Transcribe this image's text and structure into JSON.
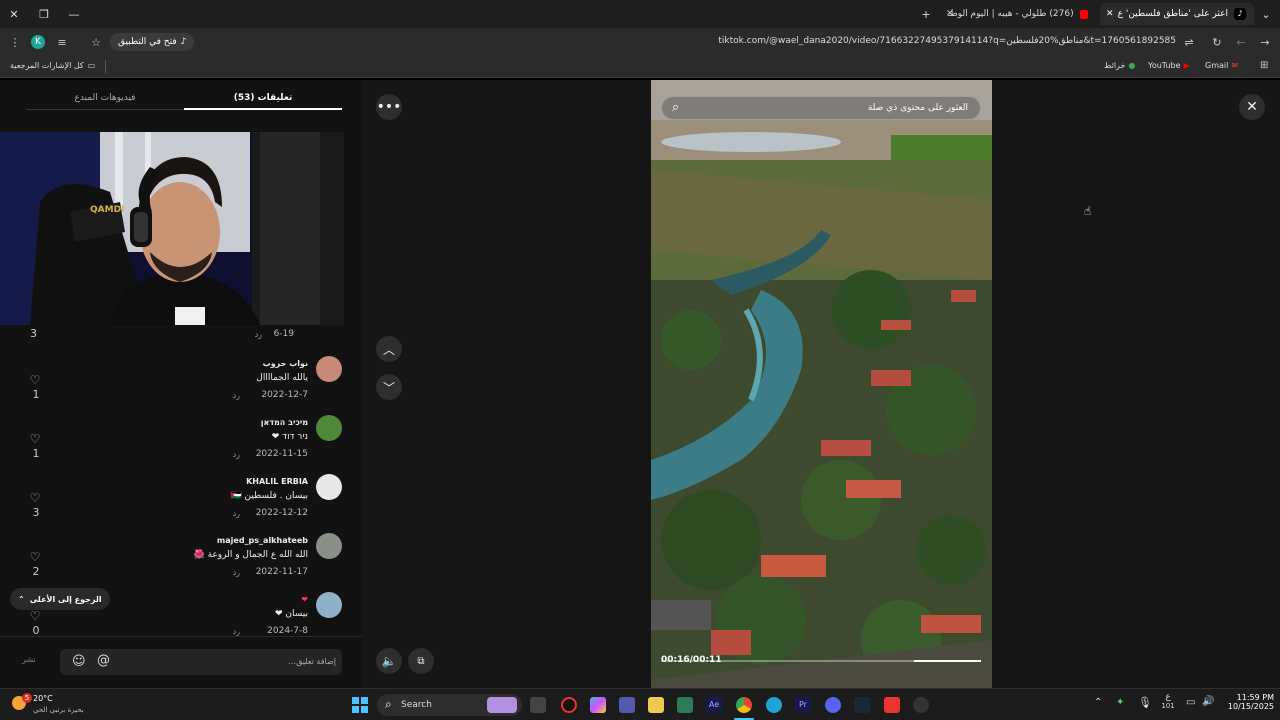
{
  "browser": {
    "tabs": [
      {
        "title": "اعثر على 'مناطق فلسطين' ع",
        "active": true
      },
      {
        "title": "(276) طلولي - هيبه | اليوم الوطـ",
        "active": false
      }
    ],
    "url": "tiktok.com/@wael_dana2020/video/7166322749537914114?q=مناطق%20فلسطين&t=1760561892585",
    "open_app_label": "فتح في التطبيق",
    "profile_initial": "K",
    "bookmarks": {
      "all_bookmarks": "كل الإشارات المرجعية",
      "items": [
        "Gmail",
        "YouTube",
        "خرائط"
      ]
    }
  },
  "comments_panel": {
    "tabs": [
      {
        "label": "تعليقات (53)",
        "active": true
      },
      {
        "label": "فيديوهات المبدع",
        "active": false
      }
    ],
    "partial_comment": {
      "date": "6-19",
      "reply": "رد",
      "likes": "3"
    },
    "comments": [
      {
        "name": "نواب حروب",
        "text": "يالله الجماااال",
        "date": "2022-12-7",
        "reply": "رد",
        "likes": "1",
        "avatar_color": "#c98a7a"
      },
      {
        "name": "מיכיב המדאן",
        "text": "ניר דוד ❤",
        "date": "2022-11-15",
        "reply": "رد",
        "likes": "1",
        "avatar_color": "#4f8a3a"
      },
      {
        "name": "KHALIL ERBIA",
        "text": "بيسان . فلسطين 🇵🇸",
        "date": "2022-12-12",
        "reply": "رد",
        "likes": "3",
        "avatar_color": "#e8e8e8"
      },
      {
        "name": "majed_ps_alkhateeb",
        "text": "الله الله ع الجمال و الروعة 🌺",
        "date": "2022-11-17",
        "reply": "رد",
        "likes": "2",
        "avatar_color": "#8a8f87"
      },
      {
        "name": "❤",
        "text": "بيسان ❤",
        "date": "2024-7-8",
        "reply": "رد",
        "likes": "0",
        "avatar_color": "#8fb1c9"
      }
    ],
    "back_to_top": "الرجوع إلى الأعلى",
    "comment_placeholder": "إضافة تعليق...",
    "post_label": "نشر"
  },
  "video": {
    "search_placeholder": "العثور على محتوى ذي صلة",
    "time": "00:16/00:11",
    "progress": 0.21
  },
  "taskbar": {
    "weather_temp": "20°C",
    "weather_text": "بحيرة برتبي الحي",
    "weather_badge": "5",
    "search_placeholder": "Search",
    "time": "11:59 PM",
    "date": "10/15/2025",
    "lang": "ع",
    "lang_sub": "101"
  },
  "colors": {
    "accent_red": "#fe2c55",
    "tiktok_bg": "#121212"
  }
}
